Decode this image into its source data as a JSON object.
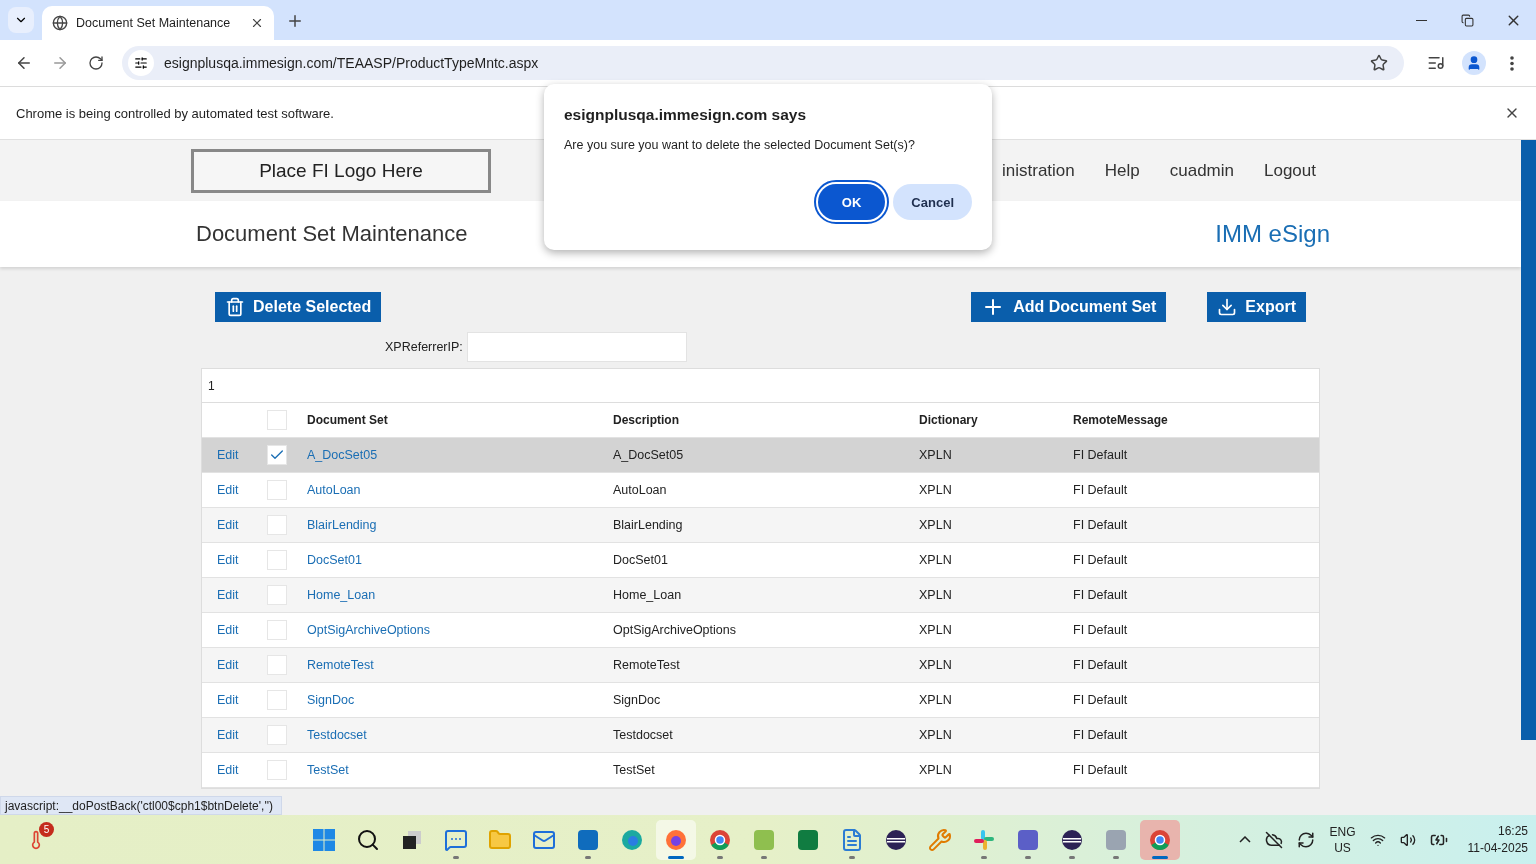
{
  "browser": {
    "tab_title": "Document Set Maintenance",
    "url": "esignplusqa.immesign.com/TEAASP/ProductTypeMntc.aspx",
    "infobar": "Chrome is being controlled by automated test software."
  },
  "header": {
    "logo": "Place FI Logo Here",
    "nav": [
      "inistration",
      "Help",
      "cuadmin",
      "Logout"
    ]
  },
  "page": {
    "title": "Document Set Maintenance",
    "brand": "IMM eSign"
  },
  "actions": [
    {
      "kind": "delete",
      "label": "Delete Selected"
    },
    {
      "kind": "add",
      "label": "Add Document Set"
    },
    {
      "kind": "export",
      "label": "Export"
    }
  ],
  "filter": {
    "label": "XPReferrerIP:"
  },
  "table": {
    "pager": "1",
    "header_checked": false,
    "columns": [
      "Document Set",
      "Description",
      "Dictionary",
      "RemoteMessage"
    ],
    "rows": [
      {
        "action": "Edit",
        "checked": true,
        "selected": true,
        "cells": [
          "A_DocSet05",
          "A_DocSet05",
          "XPLN",
          "FI Default"
        ]
      },
      {
        "action": "Edit",
        "checked": false,
        "selected": false,
        "cells": [
          "AutoLoan",
          "AutoLoan",
          "XPLN",
          "FI Default"
        ]
      },
      {
        "action": "Edit",
        "checked": false,
        "selected": false,
        "cells": [
          "BlairLending",
          "BlairLending",
          "XPLN",
          "FI Default"
        ]
      },
      {
        "action": "Edit",
        "checked": false,
        "selected": false,
        "cells": [
          "DocSet01",
          "DocSet01",
          "XPLN",
          "FI Default"
        ]
      },
      {
        "action": "Edit",
        "checked": false,
        "selected": false,
        "cells": [
          "Home_Loan",
          "Home_Loan",
          "XPLN",
          "FI Default"
        ]
      },
      {
        "action": "Edit",
        "checked": false,
        "selected": false,
        "cells": [
          "OptSigArchiveOptions",
          "OptSigArchiveOptions",
          "XPLN",
          "FI Default"
        ]
      },
      {
        "action": "Edit",
        "checked": false,
        "selected": false,
        "cells": [
          "RemoteTest",
          "RemoteTest",
          "XPLN",
          "FI Default"
        ]
      },
      {
        "action": "Edit",
        "checked": false,
        "selected": false,
        "cells": [
          "SignDoc",
          "SignDoc",
          "XPLN",
          "FI Default"
        ]
      },
      {
        "action": "Edit",
        "checked": false,
        "selected": false,
        "cells": [
          "Testdocset",
          "Testdocset",
          "XPLN",
          "FI Default"
        ]
      },
      {
        "action": "Edit",
        "checked": false,
        "selected": false,
        "cells": [
          "TestSet",
          "TestSet",
          "XPLN",
          "FI Default"
        ]
      }
    ]
  },
  "status_link": "javascript:__doPostBack('ctl00$cph1$btnDelete','')",
  "dialog": {
    "title": "esignplusqa.immesign.com says",
    "message": "Are you sure you want to delete the selected Document Set(s)?",
    "buttons": [
      {
        "label": "OK",
        "kind": "primary"
      },
      {
        "label": "Cancel",
        "kind": "secondary"
      }
    ]
  },
  "taskbar": {
    "weather_badge": "5",
    "apps": [
      {
        "running": false,
        "active": false
      },
      {
        "running": false,
        "active": false
      },
      {
        "running": false,
        "active": false
      },
      {
        "running": true,
        "active": false
      },
      {
        "running": false,
        "active": false
      },
      {
        "running": false,
        "active": false
      },
      {
        "running": true,
        "active": false
      },
      {
        "running": false,
        "active": false
      },
      {
        "running": true,
        "active": true
      },
      {
        "running": true,
        "active": false
      },
      {
        "running": true,
        "active": false
      },
      {
        "running": false,
        "active": false
      },
      {
        "running": true,
        "active": false
      },
      {
        "running": false,
        "active": false
      },
      {
        "running": false,
        "active": false
      },
      {
        "running": true,
        "active": false
      },
      {
        "running": true,
        "active": false
      },
      {
        "running": true,
        "active": false
      },
      {
        "running": true,
        "active": false
      },
      {
        "running": true,
        "active": true
      }
    ],
    "lang": "ENG",
    "region": "US",
    "time": "16:25",
    "date": "11-04-2025"
  }
}
